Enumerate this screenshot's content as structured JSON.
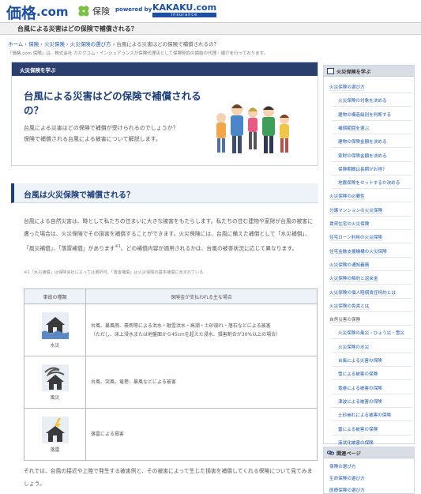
{
  "header": {
    "logo_kakaku": "価格",
    "logo_com": ".com",
    "hoken_label": "保険",
    "powered_by": "powered by",
    "kakaku_com": "KAKAKU.com",
    "insurance": "insurance"
  },
  "page_title": "台風による災害はどの保険で補償される？",
  "breadcrumb": {
    "items": [
      "ホーム",
      "保険",
      "火災保険",
      "火災保険の選び方"
    ],
    "current": "台風による災害はどの保険で補償されるの？",
    "sep": "›"
  },
  "disclaimer": "「価格.com 保険」は、株式会社 カカクコム・インシュアランスが保険代理店として保険契約の締結の代理・媒介を行っております。",
  "article": {
    "category": "火災保険を学ぶ",
    "title": "台風による災害はどの保険で補償されるの？",
    "lead": "台風による災害はどの保険で補償が受けられるのでしょうか？\n保険で補償される台風による被害について解説します。"
  },
  "section": {
    "title": "台風は火災保険で補償される？",
    "body": "台風による自然災害は、時として私たちの住まいに大きな被害をもたらします。私たちの住む建物や家財が台風の被害に遭った場合は、火災保険でその損害を補償することができます。火災保険には、台風に備えた補償として「水災補償」、「風災補償」、「落雷補償」があります",
    "body_sup": "※1",
    "body_tail": "。どの補償内容が適用されるかは、台風の被害状況に応じて異なります。",
    "note": "※1「水災補償」は保険会社によっては選択可。「落雷補償」は火災保険の基本補償に含まれている"
  },
  "table": {
    "headers": [
      "事故の種類",
      "保険金が支払われる主な場合"
    ],
    "rows": [
      {
        "label": "水災",
        "icon": "flood-house-icon",
        "desc": "台風、暴風雨、豪雨等による洪水・融雪洪水・高潮・土砂崩れ・落石などによる被害",
        "desc2": "（ただし、床上浸水または地盤面から45cmを超えた浸水、損害割合が30%以上の場合）"
      },
      {
        "label": "風災",
        "icon": "storm-house-icon",
        "desc": "台風、突風、竜巻、暴風などによる被害",
        "desc2": ""
      },
      {
        "label": "落雷",
        "icon": "lightning-house-icon",
        "desc": "落雷による損害",
        "desc2": ""
      }
    ]
  },
  "conclusion": "それでは、台風の接近や上陸で発生する被害例と、その被害によって生じた損害を補償してくれる保険について見てみましょう。",
  "sidebar": {
    "title": "火災保険を学ぶ",
    "items": [
      {
        "label": "火災保険の選び方",
        "level": "top"
      },
      {
        "label": "火災保険の対象を決める",
        "level": "sub"
      },
      {
        "label": "建物の構造級別を判断する",
        "level": "sub"
      },
      {
        "label": "補償範囲を選ぶ",
        "level": "sub"
      },
      {
        "label": "建物の保険金額を決める",
        "level": "sub"
      },
      {
        "label": "家財の保険金額を決める",
        "level": "sub"
      },
      {
        "label": "保険期間は長期がお得？",
        "level": "sub"
      },
      {
        "label": "地震保険をセットするか決める",
        "level": "sub"
      },
      {
        "label": "火災保険の必要性",
        "level": "top"
      },
      {
        "label": "分譲マンションの火災保険",
        "level": "top"
      },
      {
        "label": "賃貸住宅の火災保険",
        "level": "top"
      },
      {
        "label": "住宅ローン利用の火災保険",
        "level": "top"
      },
      {
        "label": "住宅金融支援機構の火災保険",
        "level": "top"
      },
      {
        "label": "火災保険の通知義務",
        "level": "top"
      },
      {
        "label": "火災保険の解約と返戻金",
        "level": "top"
      },
      {
        "label": "火災保険の個人賠償責任特約とは",
        "level": "top"
      },
      {
        "label": "火災保険の免責とは",
        "level": "top"
      },
      {
        "label": "自然災害の保険",
        "level": "top_plain"
      },
      {
        "label": "火災保険の風災・ひょう災・雪災",
        "level": "sub"
      },
      {
        "label": "火災保険の水災",
        "level": "sub"
      },
      {
        "label": "台風による災害の保険",
        "level": "sub"
      },
      {
        "label": "雪による被害の保険",
        "level": "sub"
      },
      {
        "label": "竜巻による被害の保険",
        "level": "sub"
      },
      {
        "label": "津波による被害の保険",
        "level": "sub"
      },
      {
        "label": "土砂崩れによる被害の保険",
        "level": "sub"
      },
      {
        "label": "雷による被害の保険",
        "level": "sub"
      },
      {
        "label": "液状化被害の保険",
        "level": "sub"
      }
    ]
  },
  "related": {
    "title": "関連ページ",
    "items": [
      "保険の選び方",
      "生命保険の選び方",
      "医療保険の選び方"
    ]
  },
  "colors": {
    "navy": "#2a3f6e",
    "link": "#1a56b0",
    "brand": "#1e4fa3"
  }
}
